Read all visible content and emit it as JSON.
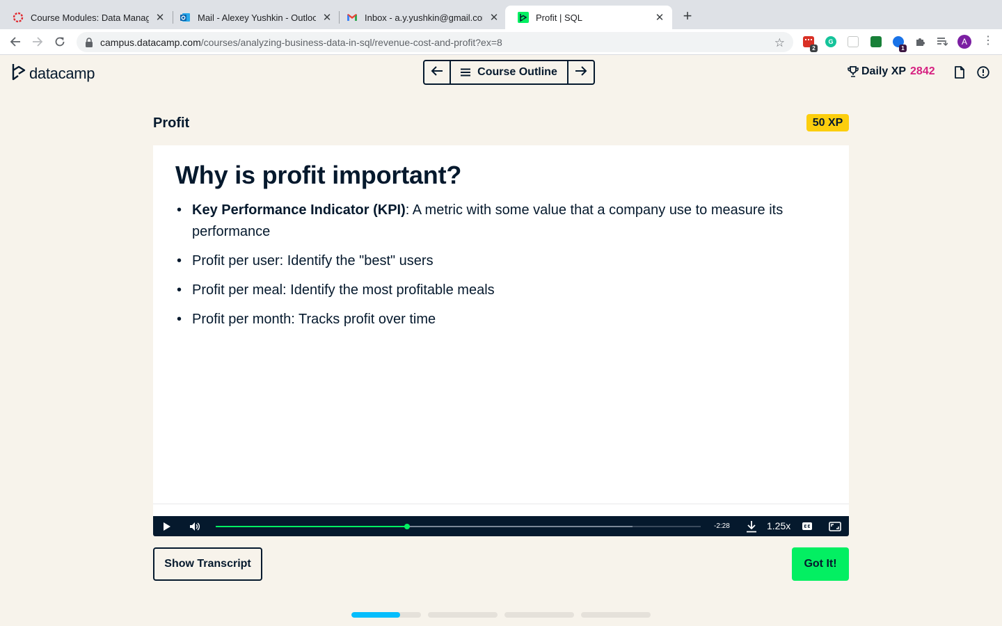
{
  "browser": {
    "tabs": [
      {
        "label": "Course Modules: Data Manage",
        "icon": "ring-logo-icon",
        "active": false
      },
      {
        "label": "Mail - Alexey Yushkin - Outlook",
        "icon": "outlook-icon",
        "active": false
      },
      {
        "label": "Inbox - a.y.yushkin@gmail.com",
        "icon": "gmail-icon",
        "active": false
      },
      {
        "label": "Profit | SQL",
        "icon": "datacamp-icon",
        "active": true
      }
    ],
    "new_tab_label": "+",
    "url_host": "campus.datacamp.com",
    "url_path": "/courses/analyzing-business-data-in-sql/revenue-cost-and-profit?ex=8",
    "extensions": [
      {
        "name": "extension-red-badge",
        "badge": "2",
        "color": "#d93025"
      },
      {
        "name": "grammarly-icon",
        "badge": "",
        "color": "#15c39a"
      },
      {
        "name": "extension-gray",
        "badge": "",
        "color": "#c4c7c5"
      },
      {
        "name": "extension-green",
        "badge": "",
        "color": "#188038"
      },
      {
        "name": "extension-blue-badge",
        "badge": "1",
        "color": "#1a73e8"
      }
    ],
    "avatar_initial": "A"
  },
  "header": {
    "logo_text": "datacamp",
    "course_outline_label": "Course Outline",
    "daily_xp_label": "Daily XP",
    "daily_xp_value": "2842"
  },
  "exercise": {
    "title": "Profit",
    "xp_badge": "50 XP"
  },
  "slide": {
    "heading": "Why is profit important?",
    "bullets": [
      {
        "bold": "Key Performance Indicator (KPI)",
        "text": ": A metric with some value that a company use to measure its performance"
      },
      {
        "bold": "",
        "text": "Profit per user: Identify the \"best\" users"
      },
      {
        "bold": "",
        "text": "Profit per meal: Identify the most profitable meals"
      },
      {
        "bold": "",
        "text": "Profit per month: Tracks profit over time"
      }
    ]
  },
  "player": {
    "played_fraction": 0.395,
    "buffered_fraction": 0.86,
    "time_remaining": "-2:28",
    "speed": "1.25x"
  },
  "actions": {
    "transcript_label": "Show Transcript",
    "got_it_label": "Got It!"
  },
  "pager": {
    "segments": [
      0.7,
      0,
      0,
      0
    ]
  },
  "colors": {
    "accent_green": "#03ef62",
    "xp_pink": "#d61f80",
    "badge_yellow": "#fcce0d",
    "progress_blue": "#06bdfc",
    "navy": "#05192d"
  }
}
